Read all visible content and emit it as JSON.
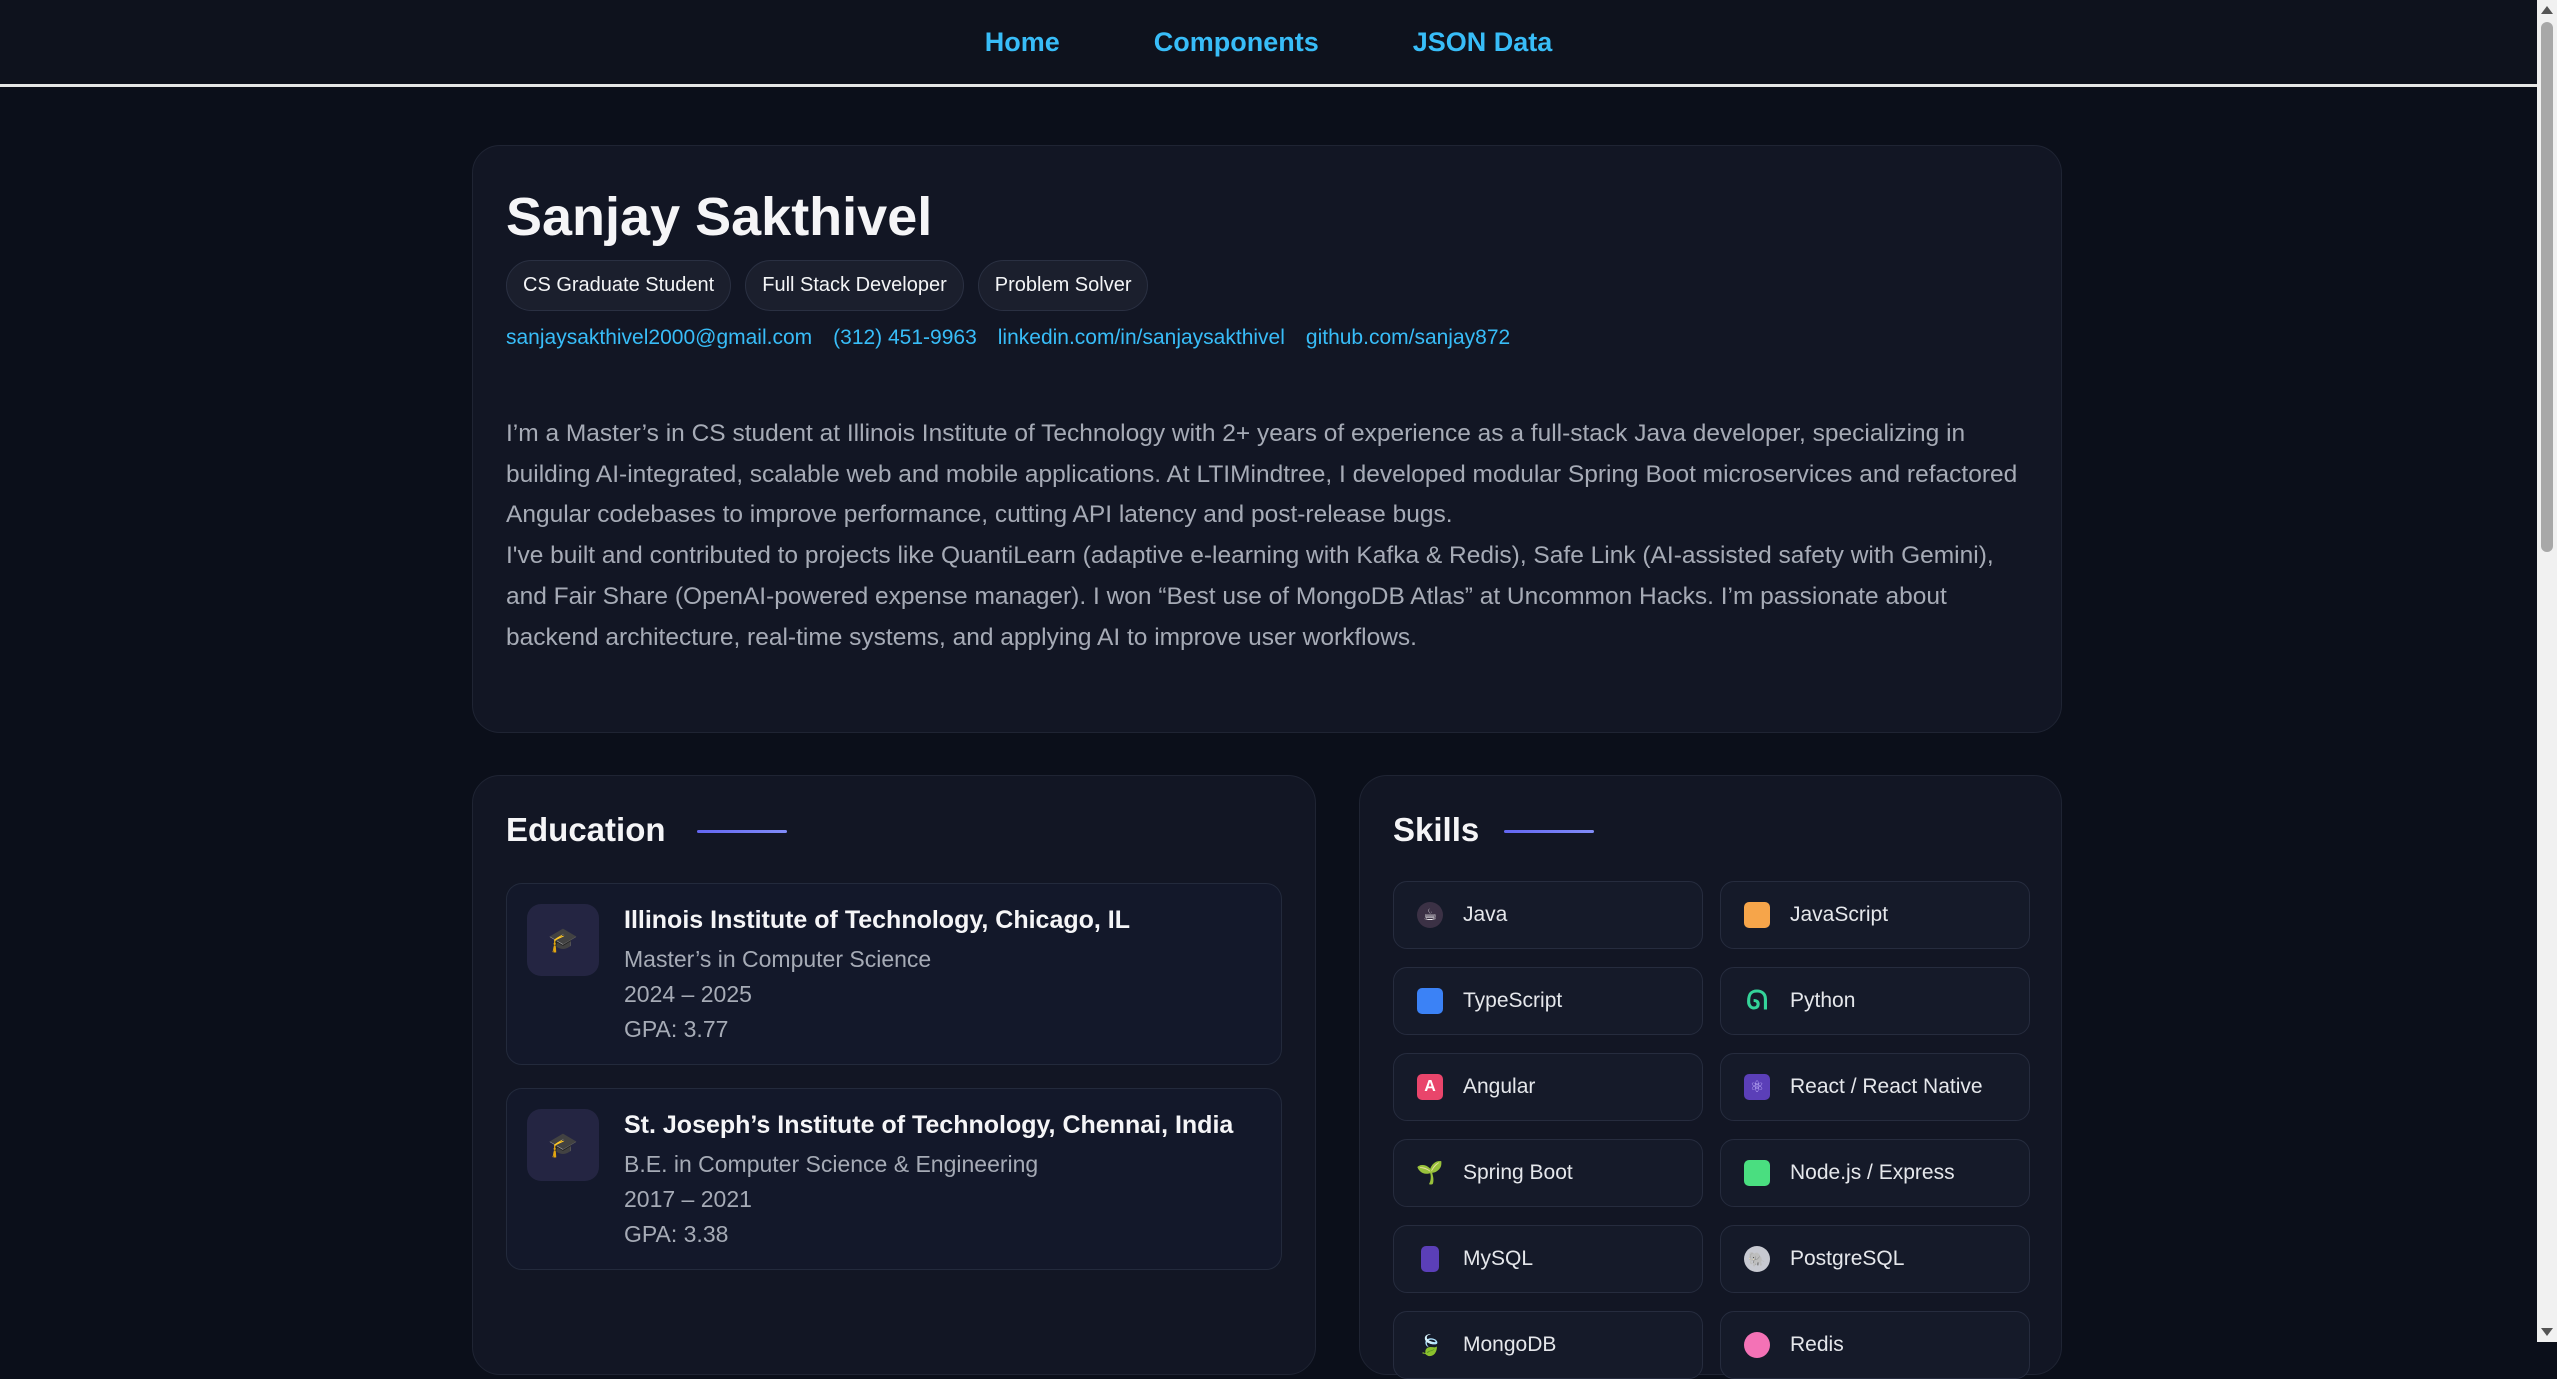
{
  "nav": {
    "items": [
      "Home",
      "Components",
      "JSON Data"
    ]
  },
  "hero": {
    "name": "Sanjay Sakthivel",
    "tags": [
      "CS Graduate Student",
      "Full Stack Developer",
      "Problem Solver"
    ],
    "contacts": {
      "email": "sanjaysakthivel2000@gmail.com",
      "phone": "(312) 451-9963",
      "linkedin": "linkedin.com/in/sanjaysakthivel",
      "github": "github.com/sanjay872"
    },
    "bio": [
      "I’m a Master’s in CS student at Illinois Institute of Technology with 2+ years of experience as a full-stack Java developer, specializing in building AI-integrated, scalable web and mobile applications. At LTIMindtree, I developed modular Spring Boot microservices and refactored Angular codebases to improve performance, cutting API latency and post-release bugs.",
      "I've built and contributed to projects like QuantiLearn (adaptive e-learning with Kafka & Redis), Safe Link (AI-assisted safety with Gemini), and Fair Share (OpenAI-powered expense manager). I won “Best use of MongoDB Atlas” at Uncommon Hacks. I’m passionate about backend architecture, real-time systems, and applying AI to improve user workflows."
    ]
  },
  "education": {
    "title": "Education",
    "items": [
      {
        "school": "Illinois Institute of Technology, Chicago, IL",
        "degree": "Master’s in Computer Science",
        "years": "2024 – 2025",
        "gpa": "GPA: 3.77"
      },
      {
        "school": "St. Joseph’s Institute of Technology, Chennai, India",
        "degree": "B.E. in Computer Science & Engineering",
        "years": "2017 – 2021",
        "gpa": "GPA: 3.38"
      }
    ]
  },
  "skills": {
    "title": "Skills",
    "items": [
      {
        "label": "Java",
        "icon": "java-icon"
      },
      {
        "label": "JavaScript",
        "icon": "javascript-icon"
      },
      {
        "label": "TypeScript",
        "icon": "typescript-icon"
      },
      {
        "label": "Python",
        "icon": "python-icon"
      },
      {
        "label": "Angular",
        "icon": "angular-icon"
      },
      {
        "label": "React / React Native",
        "icon": "react-icon"
      },
      {
        "label": "Spring Boot",
        "icon": "spring-boot-icon"
      },
      {
        "label": "Node.js / Express",
        "icon": "nodejs-icon"
      },
      {
        "label": "MySQL",
        "icon": "mysql-icon"
      },
      {
        "label": "PostgreSQL",
        "icon": "postgresql-icon"
      },
      {
        "label": "MongoDB",
        "icon": "mongodb-icon"
      },
      {
        "label": "Redis",
        "icon": "redis-icon"
      }
    ]
  },
  "colors": {
    "accent": "#38bdf8",
    "background": "#0b0f1a",
    "card": "#121624"
  }
}
